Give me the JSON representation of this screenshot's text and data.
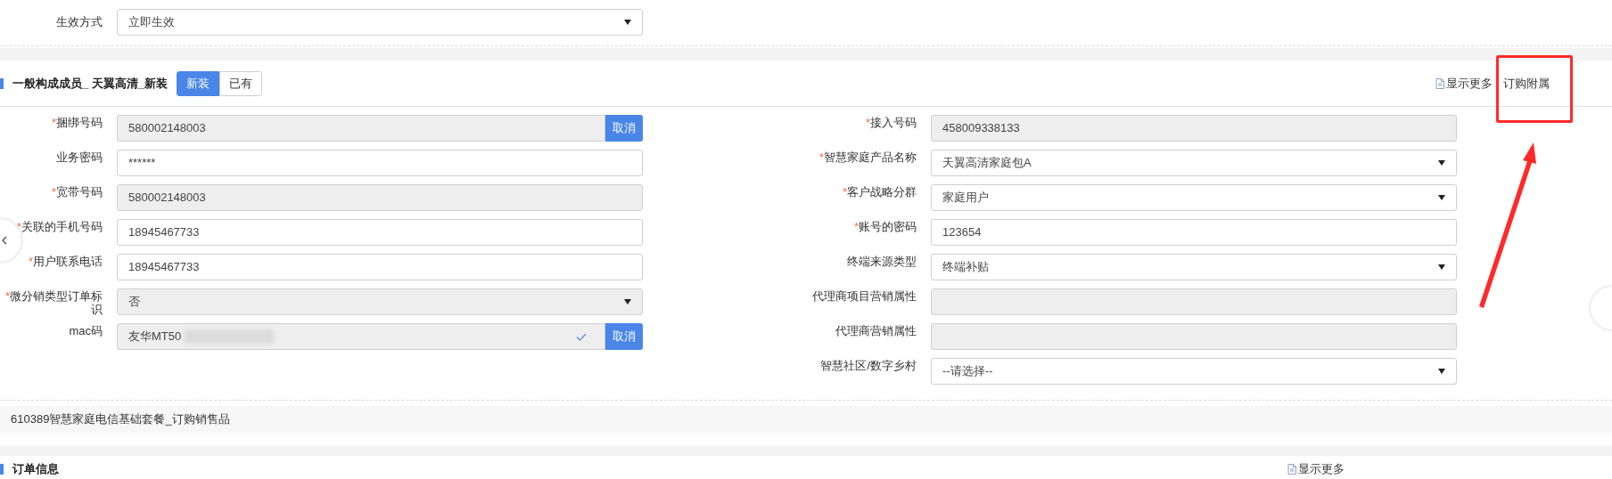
{
  "top_field": {
    "label": "生效方式",
    "value": "立即生效"
  },
  "section": {
    "title": "一般构成成员_ 天翼高清_新装",
    "toggle": [
      {
        "label": "新装",
        "selected": true
      },
      {
        "label": "已有",
        "selected": false
      }
    ],
    "show_more": "显示更多",
    "subscribe_link": "订购附属"
  },
  "left_fields": [
    {
      "label": "捆绑号码",
      "required_mark": "*",
      "kind": "input",
      "disabled": true,
      "value": "580002148003",
      "button": "取消"
    },
    {
      "label": "业务密码",
      "kind": "input",
      "disabled": false,
      "value": "******"
    },
    {
      "label": "宽带号码",
      "required_mark": "*",
      "kind": "input",
      "disabled": true,
      "value": "580002148003"
    },
    {
      "label": "关联的手机号码",
      "required_mark": "*",
      "kind": "input",
      "disabled": false,
      "value": "18945467733"
    },
    {
      "label": "用户联系电话",
      "required_mark": "*",
      "kind": "input",
      "disabled": false,
      "value": "18945467733"
    },
    {
      "label": "微分销类型订单标识",
      "required_mark": "*",
      "kind": "select",
      "disabled": true,
      "value": "否"
    },
    {
      "label": "mac码",
      "kind": "input",
      "disabled": true,
      "value": "友华MT50",
      "verified": true,
      "redacted": true,
      "button": "取消"
    }
  ],
  "right_fields": [
    {
      "label": "接入号码",
      "required_mark": "*",
      "kind": "input",
      "disabled": true,
      "value": "458009338133"
    },
    {
      "label": "智慧家庭产品名称",
      "required_mark": "*",
      "kind": "select",
      "disabled": false,
      "value": "天翼高清家庭包A"
    },
    {
      "label": "客户战略分群",
      "required_mark": "*",
      "kind": "select",
      "disabled": false,
      "value": "家庭用户"
    },
    {
      "label": "账号的密码",
      "required_mark": "*",
      "kind": "input",
      "disabled": false,
      "value": "123654"
    },
    {
      "label": "终端来源类型",
      "kind": "select",
      "disabled": false,
      "value": "终端补贴"
    },
    {
      "label": "代理商项目营销属性",
      "kind": "input",
      "disabled": true
    },
    {
      "label": "代理商营销属性",
      "kind": "input",
      "disabled": true
    },
    {
      "label": "智慧社区/数字乡村",
      "kind": "select",
      "disabled": false,
      "value": "--请选择--"
    }
  ],
  "package_title": "610389智慧家庭电信基础套餐_订购销售品",
  "next_section": {
    "title": "订单信息",
    "show_more": "显示更多"
  }
}
